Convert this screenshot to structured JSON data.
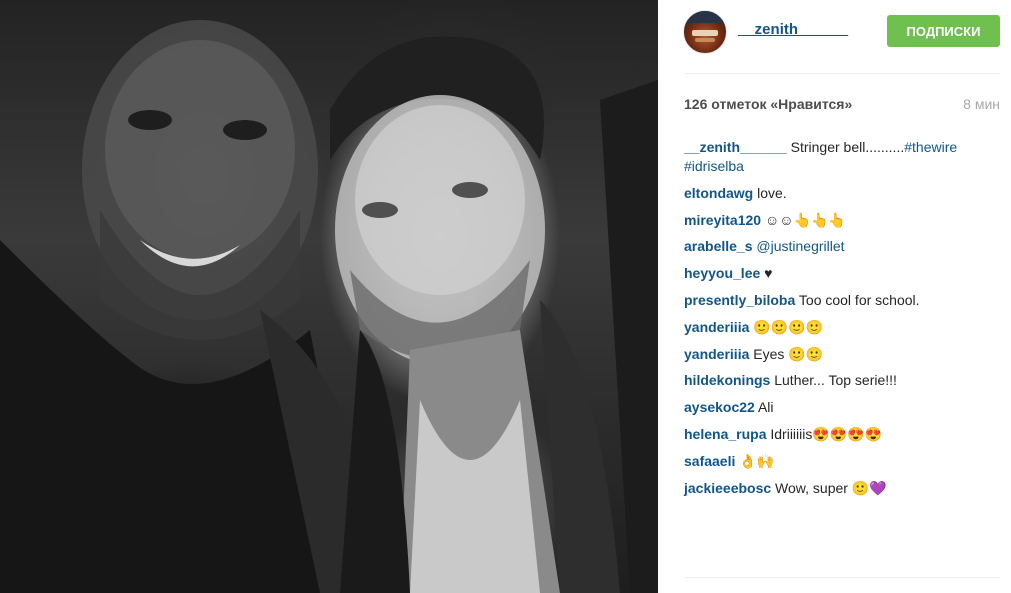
{
  "post": {
    "author": "__zenith______",
    "follow_button": "ПОДПИСКИ",
    "likes_text": "126 отметок «Нравится»",
    "time_ago": "8 мин"
  },
  "comments": [
    {
      "user": "__zenith______",
      "text": " Stringer bell..........",
      "tag": "#thewire",
      "tag2": "#idriselba"
    },
    {
      "user": "eltondawg",
      "text": " love."
    },
    {
      "user": "mireyita120",
      "text": " ☺☺👆👆👆"
    },
    {
      "user": "arabelle_s",
      "text": " ",
      "tag": "@justinegrillet"
    },
    {
      "user": "heyyou_lee",
      "text": " ♥"
    },
    {
      "user": "presently_biloba",
      "text": " Too cool for school."
    },
    {
      "user": "yanderiiia",
      "text": " 🙂🙂🙂🙂"
    },
    {
      "user": "yanderiiia",
      "text": " Eyes 🙂🙂"
    },
    {
      "user": "hildekonings",
      "text": " Luther... Top serie!!!"
    },
    {
      "user": "aysekoc22",
      "text": " Ali"
    },
    {
      "user": "helena_rupa",
      "text": " Idriiiiiis😍😍😍😍"
    },
    {
      "user": "safaaeli",
      "text": " 👌🙌"
    },
    {
      "user": "jackieeebosc",
      "text": " Wow, super 🙂💜"
    }
  ],
  "icons": {
    "avatar": "profile-avatar"
  },
  "colors": {
    "link": "#125688",
    "follow_button": "#70c050",
    "time": "#a5a7aa"
  }
}
